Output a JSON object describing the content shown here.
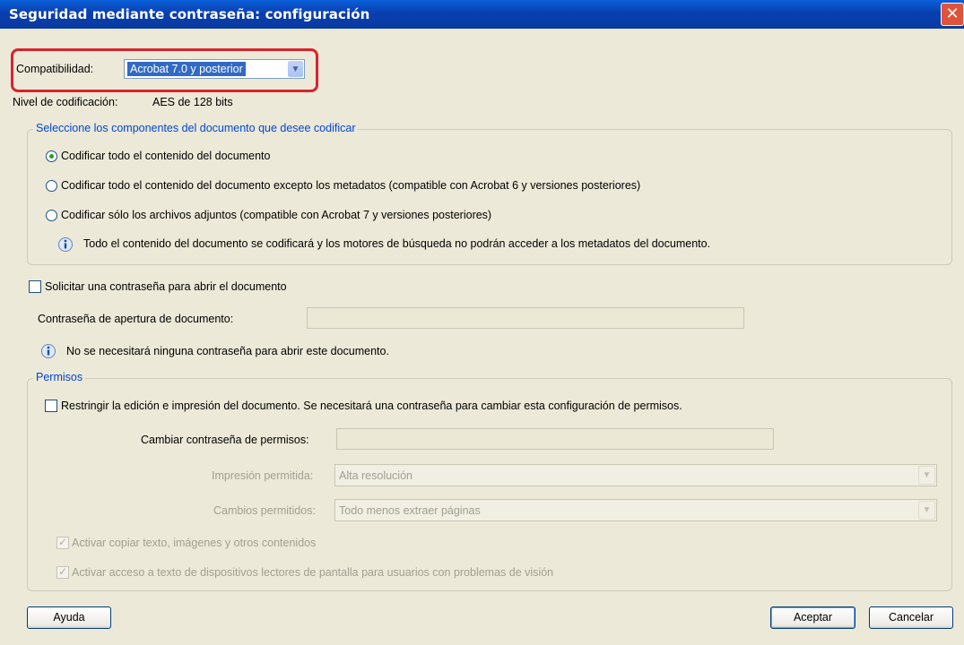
{
  "window": {
    "title": "Seguridad mediante contraseña: configuración"
  },
  "compat": {
    "label": "Compatibilidad:",
    "value": "Acrobat 7.0 y posterior"
  },
  "encryption": {
    "label": "Nivel de codificación:",
    "value": "AES de 128 bits"
  },
  "components": {
    "legend": "Seleccione los componentes del documento que desee codificar",
    "options": [
      {
        "label": "Codificar todo el contenido del documento",
        "selected": true
      },
      {
        "label": "Codificar todo el contenido del documento excepto los metadatos (compatible con Acrobat 6 y versiones posteriores)",
        "selected": false
      },
      {
        "label": "Codificar sólo los archivos adjuntos (compatible con Acrobat 7 y versiones posteriores)",
        "selected": false
      }
    ],
    "info": "Todo el contenido del documento se codificará y los motores de búsqueda no podrán acceder a los metadatos del documento."
  },
  "open_password": {
    "checkbox_label": "Solicitar una contraseña para abrir el documento",
    "field_label": "Contraseña de apertura de documento:",
    "field_value": "",
    "info": "No se necesitará ninguna contraseña para abrir este documento."
  },
  "permissions": {
    "legend": "Permisos",
    "restrict_label": "Restringir la edición e impresión del documento. Se necesitará una contraseña para cambiar esta configuración de permisos.",
    "change_password_label": "Cambiar contraseña de permisos:",
    "printing_label": "Impresión permitida:",
    "printing_value": "Alta resolución",
    "changes_label": "Cambios permitidos:",
    "changes_value": "Todo menos extraer páginas",
    "copy_label": "Activar copiar texto, imágenes y otros contenidos",
    "screen_reader_label": "Activar acceso a texto de dispositivos lectores de pantalla para usuarios con problemas de visión"
  },
  "buttons": {
    "help": "Ayuda",
    "ok": "Aceptar",
    "cancel": "Cancelar"
  }
}
